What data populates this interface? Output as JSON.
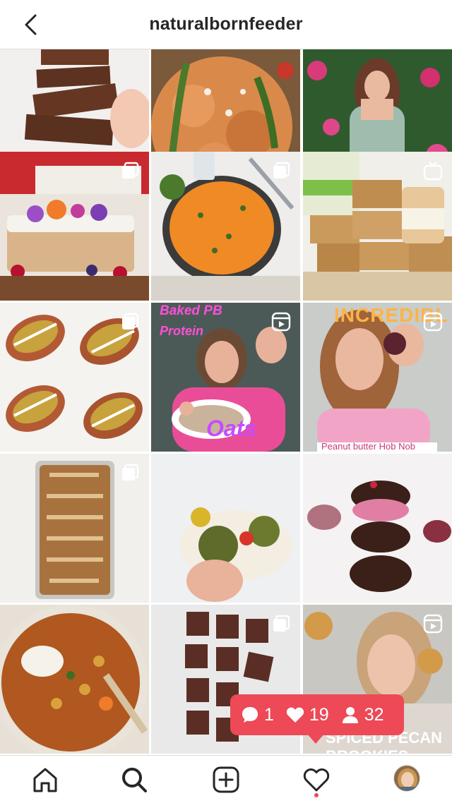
{
  "header": {
    "username": "naturalbornfeeder",
    "back_icon": "chevron-left-icon"
  },
  "posts": [
    {
      "subject": "chocolate bars",
      "badge": "none"
    },
    {
      "subject": "sweet potato with cheese",
      "badge": "none"
    },
    {
      "subject": "woman in floral dress",
      "badge": "none"
    },
    {
      "subject": "flower decorated cake",
      "badge": "carousel"
    },
    {
      "subject": "orange pasta in skillet",
      "badge": "carousel"
    },
    {
      "subject": "flapjack bars with lifeforce jar",
      "badge": "igtv"
    },
    {
      "subject": "loaded sweet potatoes",
      "badge": "carousel"
    },
    {
      "subject": "baked pb protein oats reel",
      "badge": "reel",
      "overlay_top": "Baked PB",
      "overlay_mid": "Protein",
      "overlay_bottom": "Oats"
    },
    {
      "subject": "peanut butter hob nob reel",
      "badge": "reel",
      "overlay_top": "INCREDIBL",
      "caption": "Peanut butter Hob Nob"
    },
    {
      "subject": "loaf cake",
      "badge": "carousel"
    },
    {
      "subject": "falafel wrap",
      "badge": "none"
    },
    {
      "subject": "chocolate covered cakes stack",
      "badge": "none"
    },
    {
      "subject": "chickpea stew",
      "badge": "none"
    },
    {
      "subject": "chocolate brownies",
      "badge": "carousel"
    },
    {
      "subject": "spiced pecan brookies reel",
      "badge": "reel",
      "caption": "SPICED PECAN BROOKIES"
    }
  ],
  "activity_popup": {
    "comments": "1",
    "likes": "19",
    "follows": "32",
    "color": "#ed4956"
  },
  "bottom_nav": {
    "items": [
      "home-icon",
      "search-icon",
      "new-post-icon",
      "activity-heart-icon",
      "profile-avatar"
    ]
  },
  "colors": {
    "text": "#262626",
    "divider": "#dbdbdb",
    "accent": "#ed4956",
    "overlay_pink": "#ff4fd8",
    "overlay_orange": "#ffb347"
  }
}
